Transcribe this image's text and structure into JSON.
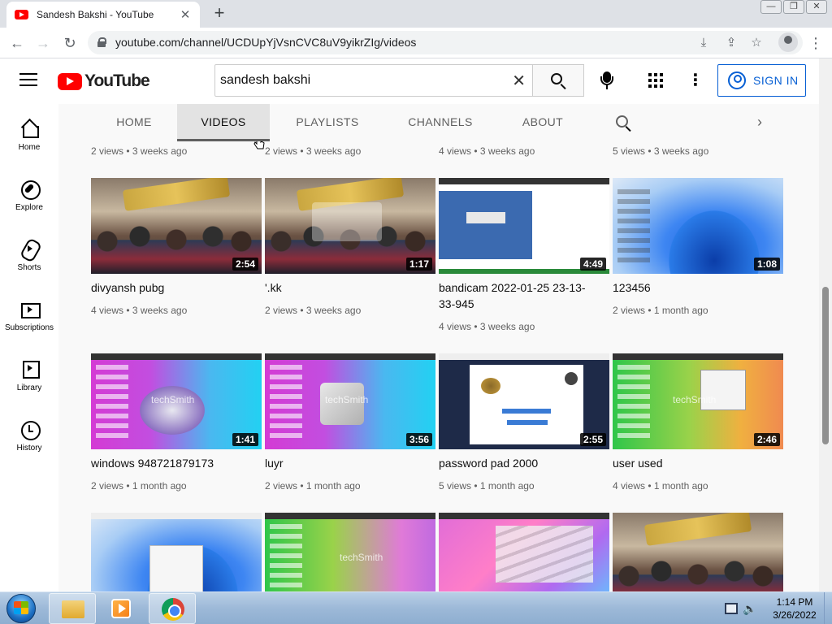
{
  "browser": {
    "tab_title": "Sandesh Bakshi - YouTube",
    "tab_close": "✕",
    "new_tab": "+",
    "url": "youtube.com/channel/UCDUpYjVsnCVC8uV9yikrZIg/videos",
    "window_controls": [
      "—",
      "❐",
      "✕"
    ]
  },
  "masthead": {
    "logo_text": "YouTube",
    "search_value": "sandesh bakshi",
    "clear_glyph": "✕",
    "signin_label": "SIGN IN"
  },
  "guide": [
    {
      "label": "Home",
      "icon": "home-icon"
    },
    {
      "label": "Explore",
      "icon": "explore-icon"
    },
    {
      "label": "Shorts",
      "icon": "shorts-icon"
    },
    {
      "label": "Subscriptions",
      "icon": "subscriptions-icon"
    },
    {
      "label": "Library",
      "icon": "library-icon"
    },
    {
      "label": "History",
      "icon": "history-icon"
    }
  ],
  "channel_tabs": [
    "HOME",
    "VIDEOS",
    "PLAYLISTS",
    "CHANNELS",
    "ABOUT"
  ],
  "active_tab": "VIDEOS",
  "top_row_meta": [
    "2 views • 3 weeks ago",
    "2 views • 3 weeks ago",
    "4 views • 3 weeks ago",
    "5 views • 3 weeks ago"
  ],
  "videos_row1": [
    {
      "title": "divyansh pubg",
      "duration": "2:54",
      "meta": "4 views • 3 weeks ago"
    },
    {
      "title": "'.kk",
      "duration": "1:17",
      "meta": "2 views • 3 weeks ago"
    },
    {
      "title": "bandicam 2022-01-25 23-13-33-945",
      "duration": "4:49",
      "meta": "4 views • 3 weeks ago"
    },
    {
      "title": "123456",
      "duration": "1:08",
      "meta": "2 views • 1 month ago"
    }
  ],
  "videos_row2": [
    {
      "title": "windows 948721879173",
      "duration": "1:41",
      "meta": "2 views • 1 month ago"
    },
    {
      "title": "luyr",
      "duration": "3:56",
      "meta": "2 views • 1 month ago"
    },
    {
      "title": "password pad 2000",
      "duration": "2:55",
      "meta": "5 views • 1 month ago"
    },
    {
      "title": "user used",
      "duration": "2:46",
      "meta": "4 views • 1 month ago"
    }
  ],
  "taskbar": {
    "time": "1:14 PM",
    "date": "3/26/2022"
  },
  "colors": {
    "yt_red": "#ff0000",
    "signin_blue": "#065fd4",
    "taskbar": "#9db9d8"
  }
}
